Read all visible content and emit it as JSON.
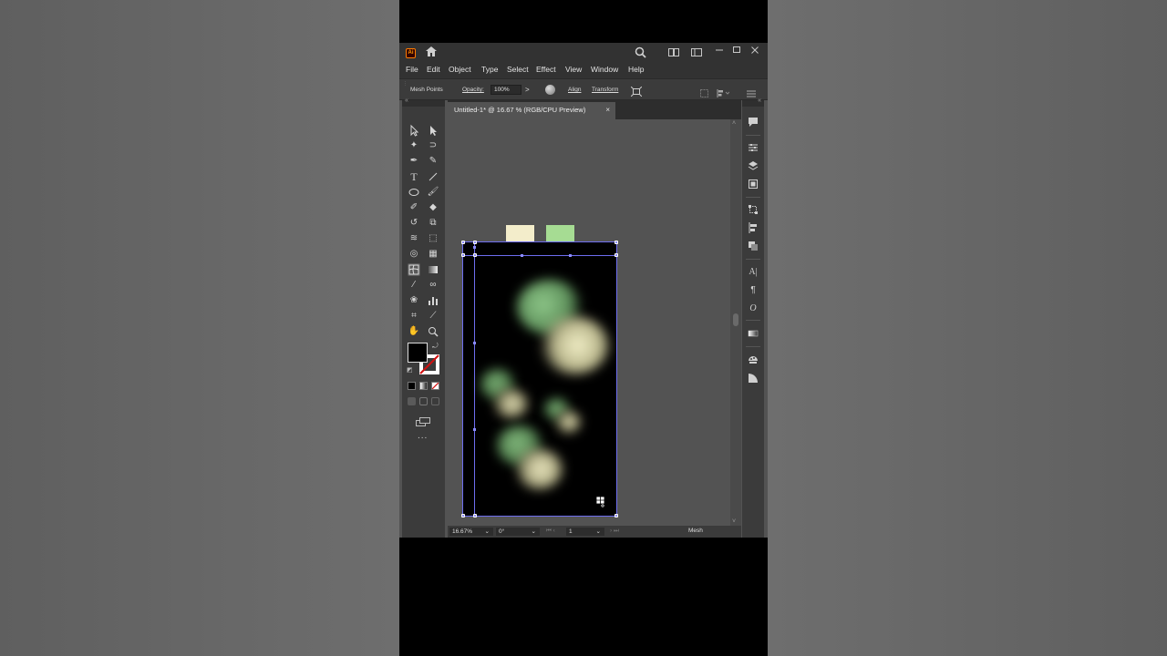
{
  "menu": [
    "File",
    "Edit",
    "Object",
    "Type",
    "Select",
    "Effect",
    "View",
    "Window",
    "Help"
  ],
  "app_logo": "Ai",
  "control_bar": {
    "mode_label": "Mesh Points",
    "opacity_label": "Opacity:",
    "opacity_value": "100%",
    "chevron": ">",
    "align_label": "Align",
    "transform_label": "Transform"
  },
  "document": {
    "tab_title": "Untitled-1* @ 16.67 % (RGB/CPU Preview)",
    "tab_close": "×"
  },
  "status_bar": {
    "zoom": "16.67%",
    "rotation": "0°",
    "artboard_index": "1",
    "tool_name": "Mesh"
  },
  "toolbar_more": "...",
  "colors": {
    "swatch_cream": "#f3edcb",
    "swatch_green": "#a6dc93",
    "fill": "#000000",
    "stroke": "none",
    "mesh_selection": "#6e6ef0",
    "blob_green": "#7ab07a",
    "blob_cream": "#f0ecc0"
  },
  "icons": {
    "search": "search-icon",
    "home": "home-icon",
    "minimize": "minimize-icon",
    "maximize": "maximize-icon",
    "close": "close-icon"
  }
}
